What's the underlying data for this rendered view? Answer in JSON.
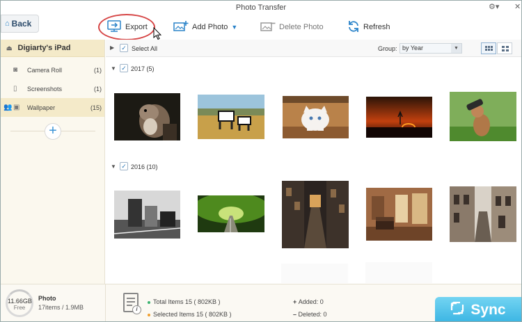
{
  "window": {
    "title": "Photo Transfer"
  },
  "toolbar": {
    "back_label": "Back",
    "export_label": "Export",
    "add_photo_label": "Add Photo",
    "delete_photo_label": "Delete Photo",
    "refresh_label": "Refresh"
  },
  "sidebar": {
    "device_name": "Digiarty's iPad",
    "items": [
      {
        "label": "Camera Roll",
        "count": "(1)",
        "icon": "camera-icon"
      },
      {
        "label": "Screenshots",
        "count": "(1)",
        "icon": "phone-icon"
      },
      {
        "label": "Wallpaper",
        "count": "(15)",
        "icon": "image-icon",
        "active": true
      }
    ],
    "add_label": "+"
  },
  "content": {
    "select_all_label": "Select All",
    "group_label": "Group:",
    "group_value": "by Year",
    "groups": [
      {
        "label": "2017 (5)",
        "photos": [
          "squirrel",
          "zebras",
          "kitten",
          "sunset",
          "cat-binoculars"
        ]
      },
      {
        "label": "2016 (10)",
        "photos": [
          "monochrome-street",
          "tree-tunnel",
          "old-alley",
          "piano-room",
          "stone-street"
        ]
      }
    ]
  },
  "footer": {
    "storage_size": "11.66GB",
    "storage_free": "Free",
    "photo_title": "Photo",
    "photo_sub": "17items / 1.9MB",
    "total_items": "Total Items 15 ( 802KB )",
    "selected_items": "Selected Items 15 ( 802KB )",
    "added": "Added: 0",
    "deleted": "Deleted: 0",
    "sync_label": "Sync"
  },
  "colors": {
    "accent": "#3a93d6",
    "sync": "#47bde6",
    "sidebar_active": "#f4eac9",
    "export_ring": "#d64545"
  }
}
